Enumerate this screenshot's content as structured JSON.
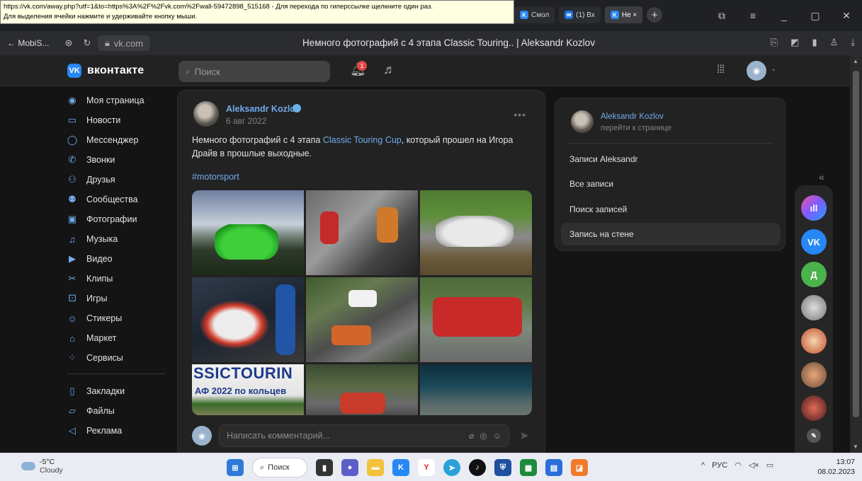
{
  "browser": {
    "tooltip_line1": "https://vk.com/away.php?utf=1&to=https%3A%2F%2Fvk.com%2Fwall-59472898_515168 - Для перехода по гиперссылке щелкните один раз.",
    "tooltip_line2": "Для выделения ячейки нажмите и удерживайте кнопку мыши.",
    "tabs": [
      {
        "label": "Смол",
        "active": false
      },
      {
        "label": "(1) Вх",
        "active": false
      },
      {
        "label": "Не ×",
        "active": true
      }
    ],
    "back_label": "← MobiS...",
    "domain": "vk.com",
    "page_title": "Немного фотографий с 4 этапа Classic Touring.. | Aleksandr Kozlov"
  },
  "header": {
    "logo_text": "вконтакте",
    "search_placeholder": "Поиск",
    "notifications_count": "1"
  },
  "sidebar": {
    "items": [
      {
        "label": "Моя страница",
        "icon": "profile-icon",
        "glyph": "◉"
      },
      {
        "label": "Новости",
        "icon": "news-icon",
        "glyph": "▭"
      },
      {
        "label": "Мессенджер",
        "icon": "messenger-icon",
        "glyph": "◯"
      },
      {
        "label": "Звонки",
        "icon": "phone-icon",
        "glyph": "✆"
      },
      {
        "label": "Друзья",
        "icon": "friends-icon",
        "glyph": "⚇"
      },
      {
        "label": "Сообщества",
        "icon": "communities-icon",
        "glyph": "⚉"
      },
      {
        "label": "Фотографии",
        "icon": "photos-icon",
        "glyph": "▣"
      },
      {
        "label": "Музыка",
        "icon": "music-icon",
        "glyph": "♫"
      },
      {
        "label": "Видео",
        "icon": "video-icon",
        "glyph": "▶"
      },
      {
        "label": "Клипы",
        "icon": "clips-icon",
        "glyph": "✂"
      },
      {
        "label": "Игры",
        "icon": "games-icon",
        "glyph": "⚀"
      },
      {
        "label": "Стикеры",
        "icon": "stickers-icon",
        "glyph": "☺"
      },
      {
        "label": "Маркет",
        "icon": "market-icon",
        "glyph": "⌂"
      },
      {
        "label": "Сервисы",
        "icon": "services-icon",
        "glyph": "⁘"
      }
    ],
    "items2": [
      {
        "label": "Закладки",
        "icon": "bookmarks-icon",
        "glyph": "▯"
      },
      {
        "label": "Файлы",
        "icon": "files-icon",
        "glyph": "▱"
      },
      {
        "label": "Реклама",
        "icon": "ads-icon",
        "glyph": "◁"
      }
    ]
  },
  "post": {
    "author": "Aleksandr Kozlov",
    "date": "6 авг 2022",
    "text_before": "Немного фотографий с 4 этапа ",
    "text_link": "Classic Touring Cup",
    "text_after": ", который прошел на Игора Драйв в прошлые выходные.",
    "hashtag": "#motorsport",
    "photo_overlay_1": "SSICTOURIN",
    "photo_overlay_2": "АФ 2022 по кольцев",
    "comment_placeholder": "Написать комментарий..."
  },
  "right_menu": {
    "name": "Aleksandr Kozlov",
    "subtitle": "перейти к странице",
    "items": [
      {
        "label": "Записи Aleksandr",
        "active": false
      },
      {
        "label": "Все записи",
        "active": false
      },
      {
        "label": "Поиск записей",
        "active": false
      },
      {
        "label": "Запись на стене",
        "active": true
      }
    ]
  },
  "rail": {
    "letter": "Д"
  },
  "taskbar": {
    "temperature": "-5°C",
    "condition": "Cloudy",
    "search_label": "Поиск",
    "language": "РУС",
    "time": "13:07",
    "date": "08.02.2023"
  },
  "colors": {
    "vk_blue": "#2787f5",
    "link": "#71aaeb",
    "badge": "#e64646"
  }
}
